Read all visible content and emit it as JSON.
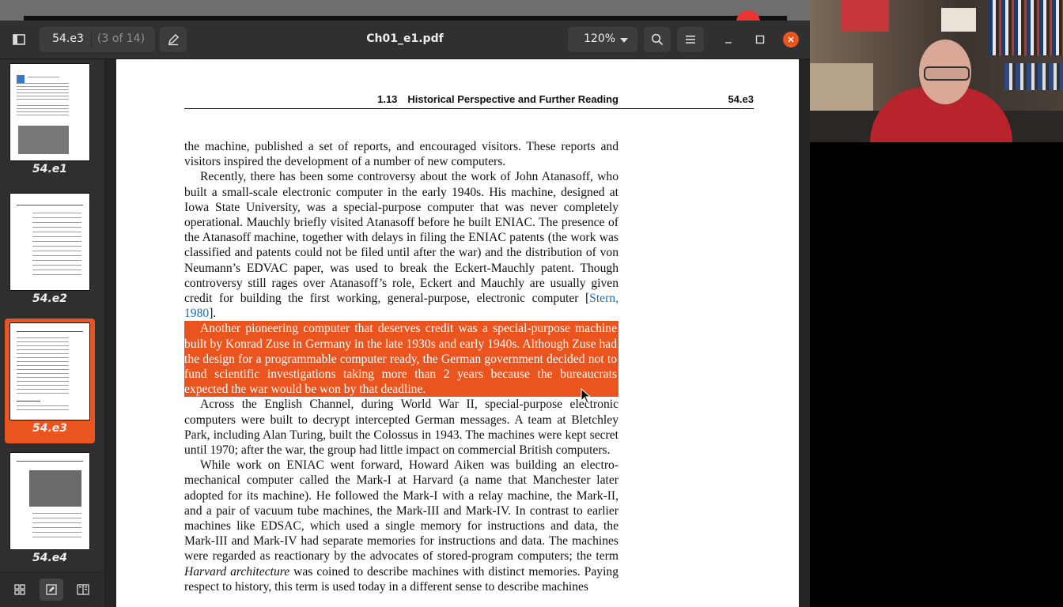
{
  "viewer": {
    "title": "Ch01_e1.pdf",
    "page_entry": {
      "value": "54.e3",
      "of_label": "(3 of 14)"
    },
    "zoom": "120%",
    "icons": {
      "sidebar_toggle": "sidebar-toggle-icon",
      "annotate": "pencil-icon",
      "search": "search-icon",
      "menu": "hamburger-menu-icon",
      "minimize": "minimize-icon",
      "maximize": "maximize-icon",
      "close": "close-icon"
    },
    "accent_color": "#e9541f"
  },
  "sidebar": {
    "thumbnails": [
      {
        "label": "54.e1",
        "selected": false
      },
      {
        "label": "54.e2",
        "selected": false
      },
      {
        "label": "54.e3",
        "selected": true
      },
      {
        "label": "54.e4",
        "selected": false
      }
    ],
    "footer": {
      "buttons": [
        {
          "icon": "grid-icon",
          "active": false
        },
        {
          "icon": "annotations-icon",
          "active": true
        },
        {
          "icon": "bookmarks-icon",
          "active": false
        }
      ]
    }
  },
  "document": {
    "running_head": {
      "title": "1.13 Historical Perspective and Further Reading",
      "page": "54.e3"
    },
    "paragraphs": [
      {
        "text": "the machine, published a set of reports, and encouraged visitors. These reports and visitors inspired the development of a number of new computers.",
        "indent": false,
        "highlighted": false
      },
      {
        "text_before": "Recently, there has been some controversy about the work of John Atanasoff, who built a small-scale electronic computer in the early 1940s. His machine, designed at Iowa State University, was a special-purpose computer that was never completely operational. Mauchly briefly visited Atanasoff before he built ENIAC. The presence of the Atanasoff machine, together with delays in filing the ENIAC patents (the work was classified and patents could not be filed until after the war) and the distribution of von Neumann’s EDVAC paper, was used to break the Eckert-Mauchly patent. Though controversy still rages over Atanasoff’s role, Eckert and Mauchly are usually given credit for building the first working, general-purpose, electronic computer [",
        "citation": "Stern, 1980",
        "text_after": "].",
        "indent": true,
        "highlighted": false
      },
      {
        "text": "Another pioneering computer that deserves credit was a special-purpose machine built by Konrad Zuse in Germany in the late 1930s and early 1940s. Although Zuse had the design for a programmable computer ready, the German government decided not to fund scientific investigations taking more than 2 years because the bureaucrats expected the war would be won by that deadline.",
        "indent": true,
        "highlighted": true
      },
      {
        "text": "Across the English Channel, during World War II, special-purpose electronic computers were built to decrypt intercepted German messages. A team at Bletchley Park, including Alan Turing, built the Colossus in 1943. The machines were kept secret until 1970; after the war, the group had little impact on commercial British computers.",
        "indent": true,
        "highlighted": false
      },
      {
        "text_before": "While work on ENIAC went forward, Howard Aiken was building an electro-mechanical computer called the Mark-I at Harvard (a name that Manchester later adopted for its machine). He followed the Mark-I with a relay machine, the Mark-II, and a pair of vacuum tube machines, the Mark-III and Mark-IV. In contrast to earlier machines like EDSAC, which used a single memory for instructions and data, the Mark-III and Mark-IV had separate memories for instructions and data. The machines were regarded as reactionary by the advocates of stored-program computers; the term ",
        "emphasis": "Harvard architecture",
        "text_after": " was coined to describe machines with distinct memories. Paying respect to history, this term is used today in a different sense to describe machines",
        "indent": true,
        "highlighted": false
      }
    ]
  }
}
